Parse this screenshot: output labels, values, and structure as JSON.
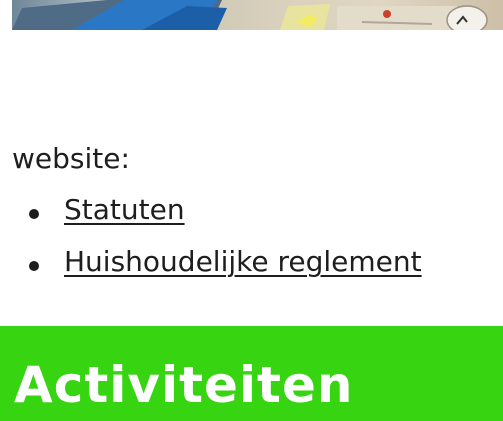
{
  "intro": {
    "text": "website:"
  },
  "documents": [
    {
      "label": "Statuten"
    },
    {
      "label": "Huishoudelijke reglement"
    }
  ],
  "section": {
    "heading": "Activiteiten",
    "color": "#37d412"
  }
}
